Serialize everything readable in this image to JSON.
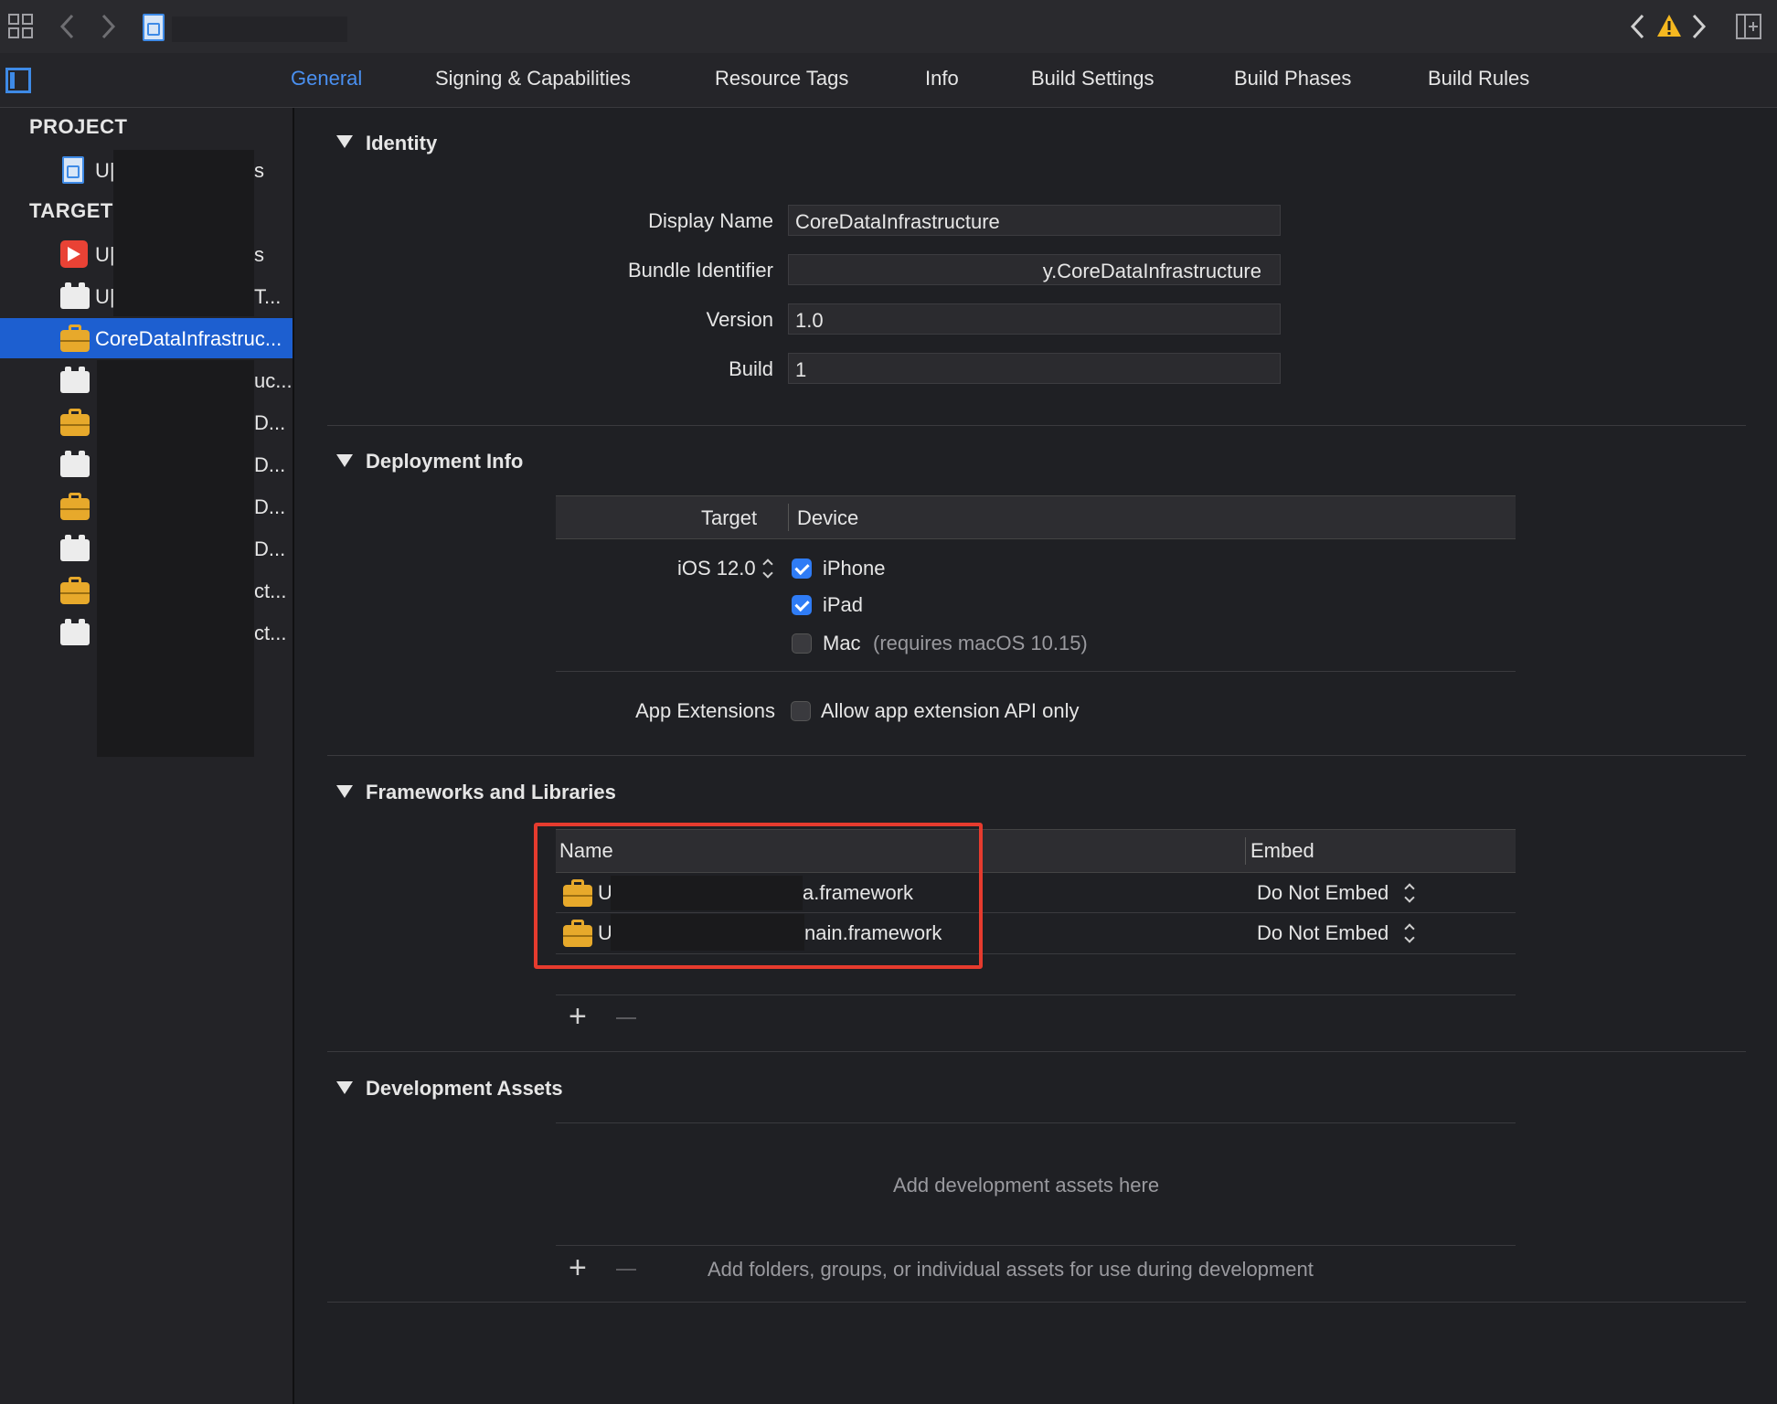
{
  "tabs": [
    {
      "label": "General",
      "active": true
    },
    {
      "label": "Signing & Capabilities"
    },
    {
      "label": "Resource Tags"
    },
    {
      "label": "Info"
    },
    {
      "label": "Build Settings"
    },
    {
      "label": "Build Phases"
    },
    {
      "label": "Build Rules"
    }
  ],
  "sidebar": {
    "project_header": "PROJECT",
    "targets_header": "TARGETS",
    "project_item": {
      "label": "U|",
      "suffix": "s"
    },
    "targets": [
      {
        "label": "U|",
        "suffix": "s",
        "icon": "app-icon"
      },
      {
        "label": "U|",
        "suffix": "T...",
        "icon": "block-icon"
      },
      {
        "label": "CoreDataInfrastruc...",
        "suffix": "",
        "icon": "toolbox-icon",
        "selected": true
      },
      {
        "label": "",
        "suffix": "uc...",
        "icon": "block-icon"
      },
      {
        "label": "",
        "suffix": "D...",
        "icon": "toolbox-icon"
      },
      {
        "label": "",
        "suffix": "D...",
        "icon": "block-icon"
      },
      {
        "label": "",
        "suffix": "D...",
        "icon": "toolbox-icon"
      },
      {
        "label": "",
        "suffix": "D...",
        "icon": "block-icon"
      },
      {
        "label": "",
        "suffix": "ct...",
        "icon": "toolbox-icon"
      },
      {
        "label": "",
        "suffix": "ct...",
        "icon": "block-icon"
      }
    ]
  },
  "identity": {
    "title": "Identity",
    "display_name_label": "Display Name",
    "display_name": "CoreDataInfrastructure",
    "bundle_id_label": "Bundle Identifier",
    "bundle_id": "y.CoreDataInfrastructure",
    "version_label": "Version",
    "version": "1.0",
    "build_label": "Build",
    "build": "1"
  },
  "deployment": {
    "title": "Deployment Info",
    "target_header": "Target",
    "device_header": "Device",
    "ios_version": "iOS 12.0",
    "devices": [
      {
        "label": "iPhone",
        "checked": true
      },
      {
        "label": "iPad",
        "checked": true
      },
      {
        "label": "Mac",
        "note": "(requires macOS 10.15)",
        "checked": false
      }
    ],
    "app_ext_label": "App Extensions",
    "app_ext_option": "Allow app extension API only"
  },
  "frameworks": {
    "title": "Frameworks and Libraries",
    "name_header": "Name",
    "embed_header": "Embed",
    "rows": [
      {
        "prefix": "U",
        "name": "a.framework",
        "embed": "Do Not Embed"
      },
      {
        "prefix": "U",
        "name": "nain.framework",
        "embed": "Do Not Embed"
      }
    ]
  },
  "dev_assets": {
    "title": "Development Assets",
    "placeholder": "Add development assets here",
    "hint": "Add folders, groups, or individual assets for use during development"
  },
  "colors": {
    "accent": "#4a90f0",
    "selection": "#1d5fd0",
    "highlight": "#e63b2e",
    "warning": "#f5b820"
  }
}
